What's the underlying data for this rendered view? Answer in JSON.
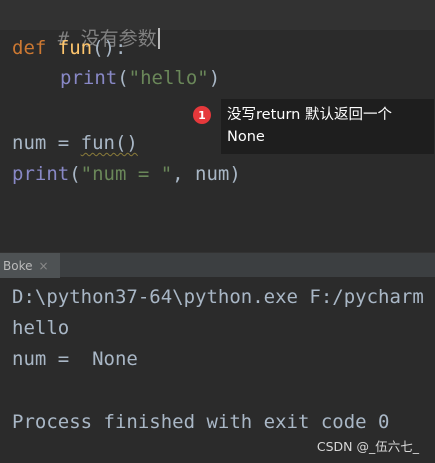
{
  "editor": {
    "lines": [
      {
        "comment": "# 没有参数"
      },
      {
        "kw": "def",
        "fn": "fun",
        "rest": "():"
      },
      {
        "builtin": "print",
        "open": "(",
        "str": "\"hello\"",
        "close": ")"
      },
      {},
      {
        "var": "num",
        "op": " = ",
        "call": "fun()"
      },
      {
        "builtin": "print",
        "open": "(",
        "str": "\"num = \"",
        "rest": ", num)"
      }
    ]
  },
  "tooltip": {
    "badge": "1",
    "text_line1": "没写return 默认返回一个",
    "text_line2": "None"
  },
  "run_panel": {
    "tab_label": "Boke",
    "close_glyph": "×"
  },
  "console": {
    "lines": [
      "D:\\python37-64\\python.exe F:/pycharm",
      "hello",
      "num =  None",
      "",
      "Process finished with exit code 0"
    ]
  },
  "watermark": "CSDN @_伍六七_",
  "colors": {
    "background": "#2b2b2b",
    "keyword": "#cc7832",
    "function": "#ffc66d",
    "builtin": "#8888c6",
    "string": "#6a8759",
    "text": "#a9b7c6",
    "comment": "#808080",
    "badge": "#e5383b"
  }
}
